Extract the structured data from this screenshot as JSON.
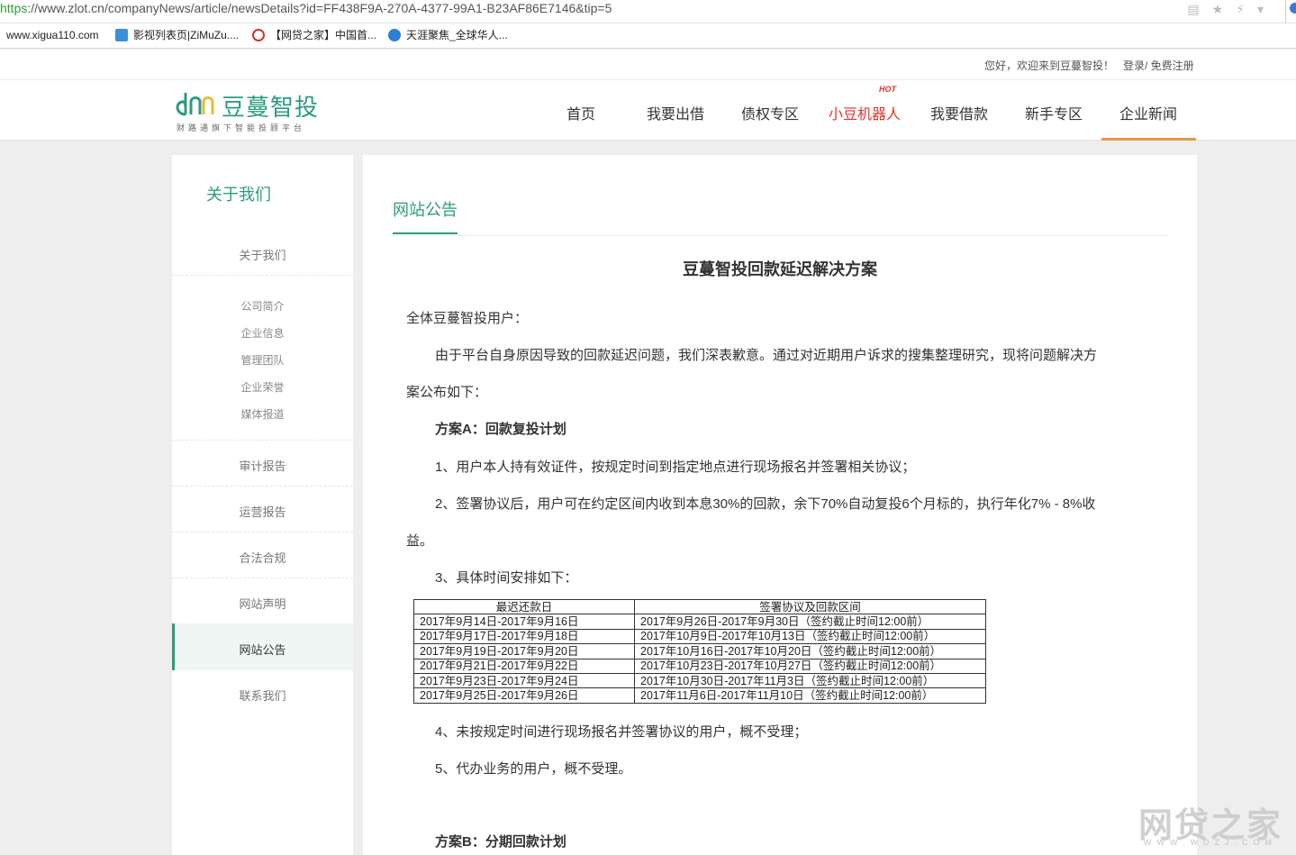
{
  "browser": {
    "url_proto": "https",
    "url_rest": "://www.zlot.cn/companyNews/article/newsDetails?id=FF438F9A-270A-4377-99A1-B23AF86E7146&tip=5",
    "favorites": [
      "www.xigua110.com",
      "影视列表页|ZiMuZu....",
      "【网贷之家】中国首...",
      "天涯聚焦_全球华人..."
    ]
  },
  "topbar": {
    "greeting": "您好，欢迎来到豆蔓智投！",
    "login": "登录/ 免费注册"
  },
  "logo": {
    "name": "豆蔓智投",
    "tagline": "财路通旗下智能投顾平台"
  },
  "nav": {
    "items": [
      "首页",
      "我要出借",
      "债权专区",
      "小豆机器人",
      "我要借款",
      "新手专区",
      "企业新闻"
    ],
    "hot_badge": "HOT",
    "active": "企业新闻"
  },
  "sidebar": {
    "title": "关于我们",
    "group_label": "关于我们",
    "sub_items": [
      "公司简介",
      "企业信息",
      "管理团队",
      "企业荣誉",
      "媒体报道"
    ],
    "items": [
      "审计报告",
      "运营报告",
      "合法合规",
      "网站声明",
      "网站公告",
      "联系我们"
    ],
    "active": "网站公告"
  },
  "main": {
    "section_title": "网站公告",
    "article": {
      "title": "豆蔓智投回款延迟解决方案",
      "greeting": "全体豆蔓智投用户：",
      "intro_1": "由于平台自身原因导致的回款延迟问题，我们深表歉意。通过对近期用户诉求的搜集整理研究，现将问题解决方",
      "intro_2": "案公布如下：",
      "plan_a": "方案A：回款复投计划",
      "item_1": "1、用户本人持有效证件，按规定时间到指定地点进行现场报名并签署相关协议；",
      "item_2a": "2、签署协议后，用户可在约定区间内收到本息30%的回款，余下70%自动复投6个月标的，执行年化7% - 8%收",
      "item_2b": "益。",
      "item_3": "3、具体时间安排如下：",
      "item_4": "4、未按规定时间进行现场报名并签署协议的用户，概不受理；",
      "item_5": "5、代办业务的用户，概不受理。",
      "plan_b": "方案B：分期回款计划"
    },
    "schedule": {
      "headers": [
        "最迟还款日",
        "签署协议及回款区间"
      ],
      "rows": [
        [
          "2017年9月14日-2017年9月16日",
          "2017年9月26日-2017年9月30日（签约截止时间12:00前）"
        ],
        [
          "2017年9月17日-2017年9月18日",
          "2017年10月9日-2017年10月13日（签约截止时间12:00前）"
        ],
        [
          "2017年9月19日-2017年9月20日",
          "2017年10月16日-2017年10月20日（签约截止时间12:00前）"
        ],
        [
          "2017年9月21日-2017年9月22日",
          "2017年10月23日-2017年10月27日（签约截止时间12:00前）"
        ],
        [
          "2017年9月23日-2017年9月24日",
          "2017年10月30日-2017年11月3日（签约截止时间12:00前）"
        ],
        [
          "2017年9月25日-2017年9月26日",
          "2017年11月6日-2017年11月10日（签约截止时间12:00前）"
        ]
      ]
    }
  },
  "watermark": {
    "text": "网贷之家",
    "sub": "WWW.WDZJ.COM"
  }
}
